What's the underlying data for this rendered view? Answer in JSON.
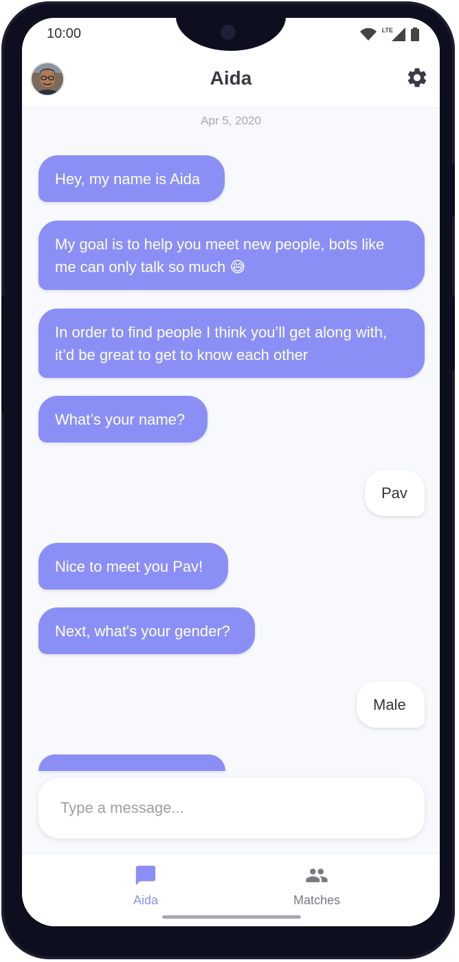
{
  "status_bar": {
    "time": "10:00",
    "network": "LTE"
  },
  "header": {
    "title": "Aida"
  },
  "chat": {
    "date": "Apr 5, 2020",
    "messages": [
      {
        "sender": "bot",
        "text": "Hey, my name is Aida"
      },
      {
        "sender": "bot",
        "text": "My goal is to help you meet new people, bots like me can only talk so much 😅"
      },
      {
        "sender": "bot",
        "text": "In order to find people I think you’ll get along with, it’d be great to get to know each other"
      },
      {
        "sender": "bot",
        "text": "What’s your name?"
      },
      {
        "sender": "user",
        "text": "Pav"
      },
      {
        "sender": "bot",
        "text": "Nice to meet you Pav!"
      },
      {
        "sender": "bot",
        "text": "Next, what's your gender?"
      },
      {
        "sender": "user",
        "text": "Male"
      },
      {
        "sender": "bot",
        "text": ""
      }
    ]
  },
  "composer": {
    "value": "",
    "placeholder": "Type a message..."
  },
  "bottom_nav": {
    "items": [
      {
        "label": "Aida",
        "icon": "chat-bubble-icon",
        "active": true
      },
      {
        "label": "Matches",
        "icon": "people-icon",
        "active": false
      }
    ]
  },
  "colors": {
    "accent": "#8b8ff5",
    "background": "#f7f9fd",
    "user_bubble": "#ffffff",
    "title_text": "#3a3a44"
  }
}
